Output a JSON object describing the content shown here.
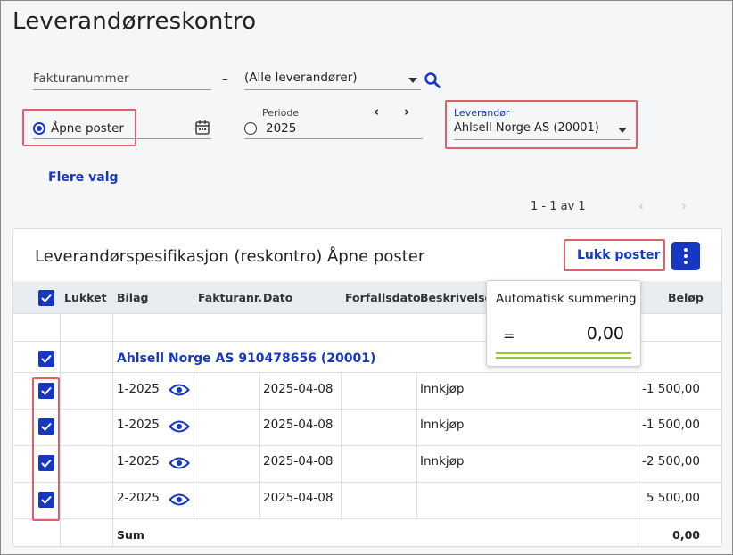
{
  "page": {
    "title": "Leverandørreskontro"
  },
  "filters": {
    "invoice_placeholder": "Fakturanummer",
    "dash": "–",
    "supplier_filter": "(Alle leverandører)",
    "open_items_label": "Åpne poster",
    "period_label": "Periode",
    "period_value": "2025",
    "supplier_label": "Leverandør",
    "supplier_value": "Ahlsell Norge AS (20001)",
    "more_options": "Flere valg"
  },
  "pagination": {
    "text": "1 - 1 av 1"
  },
  "card": {
    "title": "Leverandørspesifikasjon (reskontro) Åpne poster",
    "close_button": "Lukk poster"
  },
  "table": {
    "headers": {
      "closed": "Lukket",
      "voucher": "Bilag",
      "invoice_no": "Fakturanr.",
      "date": "Dato",
      "due_date": "Forfallsdato",
      "description": "Beskrivelse",
      "amount": "Beløp"
    },
    "group_label": "Ahlsell Norge AS 910478656 (20001)",
    "rows": [
      {
        "voucher": "1-2025",
        "date": "2025-04-08",
        "description": "Innkjøp",
        "amount": "-1 500,00"
      },
      {
        "voucher": "1-2025",
        "date": "2025-04-08",
        "description": "Innkjøp",
        "amount": "-1 500,00"
      },
      {
        "voucher": "1-2025",
        "date": "2025-04-08",
        "description": "Innkjøp",
        "amount": "-2 500,00"
      },
      {
        "voucher": "2-2025",
        "date": "2025-04-08",
        "description": "",
        "amount": "5 500,00"
      }
    ],
    "sum_label": "Sum",
    "sum_value": "0,00"
  },
  "tooltip": {
    "title": "Automatisk summering",
    "eq": "=",
    "value": "0,00"
  },
  "colors": {
    "accent": "#1537c4",
    "highlight": "#e0606a",
    "underline": "#9bc23c"
  }
}
